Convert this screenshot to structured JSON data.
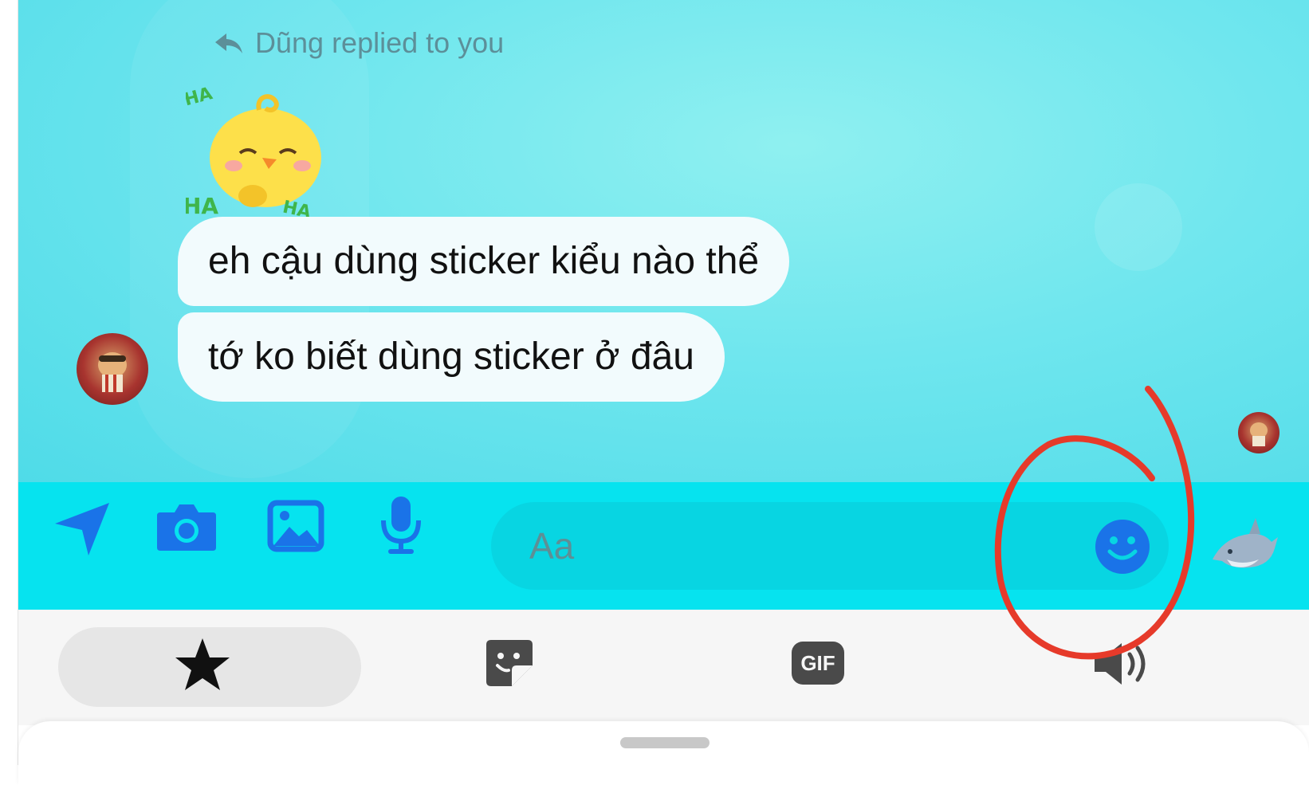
{
  "thread": {
    "reply_notice": "Dũng replied to you",
    "messages": [
      "eh cậu dùng sticker kiểu nào thể",
      "tớ ko biết dùng sticker ở đâu"
    ],
    "sticker": {
      "caption": "HA HA HA"
    }
  },
  "composer": {
    "placeholder": "Aa",
    "icons": [
      "location-arrow-icon",
      "camera-icon",
      "image-icon",
      "microphone-icon",
      "smiley-emoji-icon",
      "dolphin-reaction-icon"
    ]
  },
  "tabs": [
    {
      "icon": "star-icon",
      "active": true
    },
    {
      "icon": "sticker-icon",
      "active": false
    },
    {
      "icon": "gif-icon",
      "label": "GIF",
      "active": false
    },
    {
      "icon": "speaker-icon",
      "active": false
    }
  ],
  "colors": {
    "accent": "#1a73e8",
    "composer_bg": "#06e3ef",
    "chat_bg": "#6fe6ee",
    "bubble_bg": "#f2fbfd",
    "annotation": "#e63a2a"
  }
}
